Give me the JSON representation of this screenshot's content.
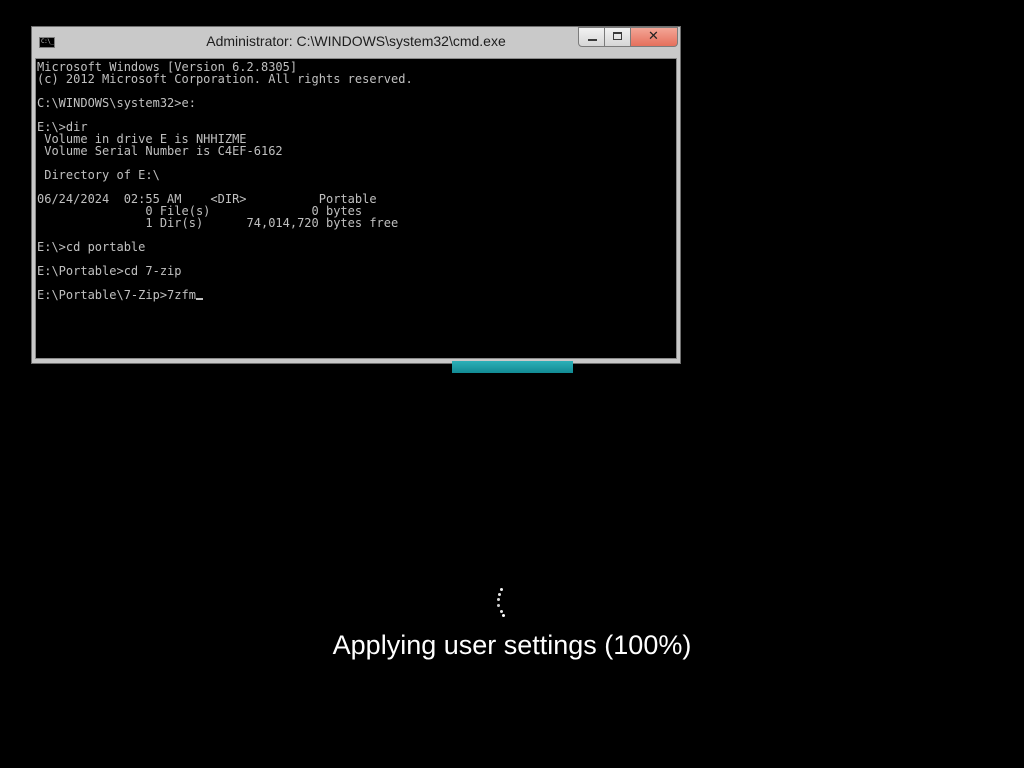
{
  "window": {
    "title": "Administrator: C:\\WINDOWS\\system32\\cmd.exe",
    "icon_label": "C:\\_",
    "controls": {
      "minimize_icon": "minimize-icon",
      "maximize_icon": "maximize-icon",
      "close_icon": "close-icon",
      "close_glyph": "✕"
    }
  },
  "console": {
    "lines": [
      "Microsoft Windows [Version 6.2.8305]",
      "(c) 2012 Microsoft Corporation. All rights reserved.",
      "",
      "C:\\WINDOWS\\system32>e:",
      "",
      "E:\\>dir",
      " Volume in drive E is NHHIZME",
      " Volume Serial Number is C4EF-6162",
      "",
      " Directory of E:\\",
      "",
      "06/24/2024  02:55 AM    <DIR>          Portable",
      "               0 File(s)              0 bytes",
      "               1 Dir(s)      74,014,720 bytes free",
      "",
      "E:\\>cd portable",
      "",
      "E:\\Portable>cd 7-zip",
      "",
      "E:\\Portable\\7-Zip>7zfm"
    ],
    "text_color": "#c0c0c0",
    "background_color": "#000000"
  },
  "progress": {
    "fraction": 1.0,
    "fill_color": "#1fa3ab"
  },
  "status": {
    "text": "Applying user settings (100%)",
    "spinner_icon": "loading-spinner-icon"
  }
}
